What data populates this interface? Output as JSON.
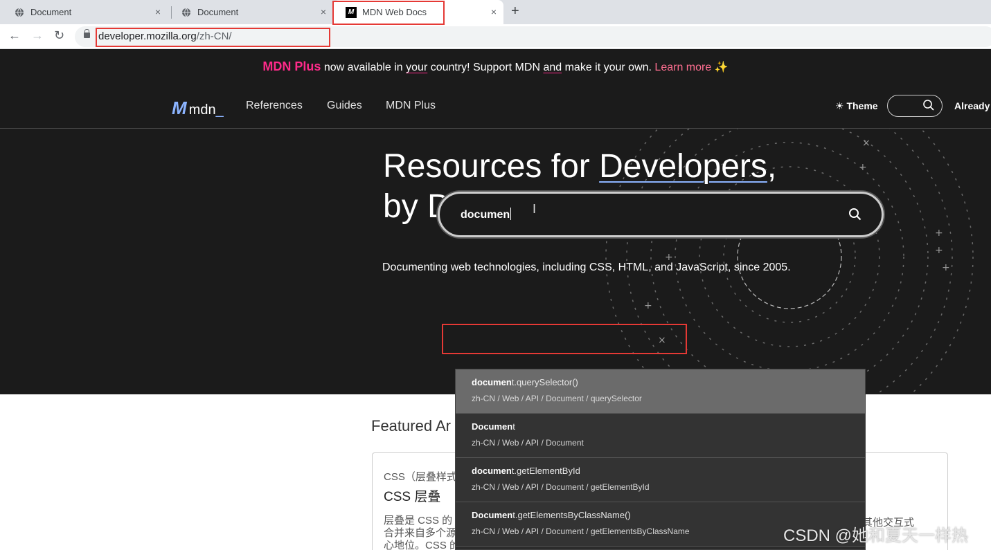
{
  "browser": {
    "tabs": [
      {
        "title": "Document",
        "close": "×"
      },
      {
        "title": "Document",
        "close": "×"
      },
      {
        "title": "MDN Web Docs",
        "close": "×"
      }
    ],
    "new_tab": "+",
    "nav": {
      "back": "←",
      "forward": "→",
      "reload": "↻"
    },
    "url_host": "developer.mozilla.org",
    "url_path": "/zh-CN/"
  },
  "banner": {
    "plus": "MDN Plus",
    "t1": " now available in ",
    "your": "your",
    "t2": " country! Support MDN ",
    "and": "and",
    "t3": " make it your own. ",
    "learn": "Learn more",
    "sparkle": "✨"
  },
  "nav": {
    "logo_text": "mdn",
    "logo_cursor": "_",
    "logo_mark": "M",
    "links": [
      "References",
      "Guides",
      "MDN Plus"
    ],
    "theme": "Theme",
    "theme_icon": "☀",
    "account": "Already"
  },
  "hero": {
    "line1_a": "Resources for ",
    "line1_b": "Developers",
    "line1_c": ",",
    "line2_a": "by Developers",
    "line2_cursor": "_",
    "subtitle": "Documenting web technologies, including CSS, HTML, and JavaScript, since 2005.",
    "search_value": "documen"
  },
  "suggestions": [
    {
      "bold": "documen",
      "rest": "t.querySelector()",
      "path": "zh-CN / Web / API / Document / querySelector"
    },
    {
      "bold": "Documen",
      "rest": "t",
      "path": "zh-CN / Web / API / Document"
    },
    {
      "bold": "documen",
      "rest": "t.getElementById",
      "path": "zh-CN / Web / API / Document / getElementById"
    },
    {
      "bold": "Documen",
      "rest": "t.getElementsByClassName()",
      "path": "zh-CN / Web / API / Document / getElementsByClassName"
    }
  ],
  "featured": {
    "heading": "Featured Ar",
    "card_kicker": "CSS（层叠样式",
    "card_title": "CSS 层叠",
    "card_line1": "层叠是 CSS 的",
    "card_line2": "合并来自多个源",
    "card_line3": "心地位。CSS 的",
    "card_tail": "成其他交互式"
  },
  "watermark": "CSDN @她和夏天一样热",
  "colors": {
    "brand_pink": "#ff2a8a",
    "accent_blue": "#8cb4ff",
    "dark_bg": "#1b1b1b",
    "annotation_red": "#e53935"
  },
  "icons": [
    "globe-icon",
    "mdn-favicon-icon",
    "lock-icon",
    "search-icon",
    "sun-icon",
    "text-cursor-icon"
  ]
}
